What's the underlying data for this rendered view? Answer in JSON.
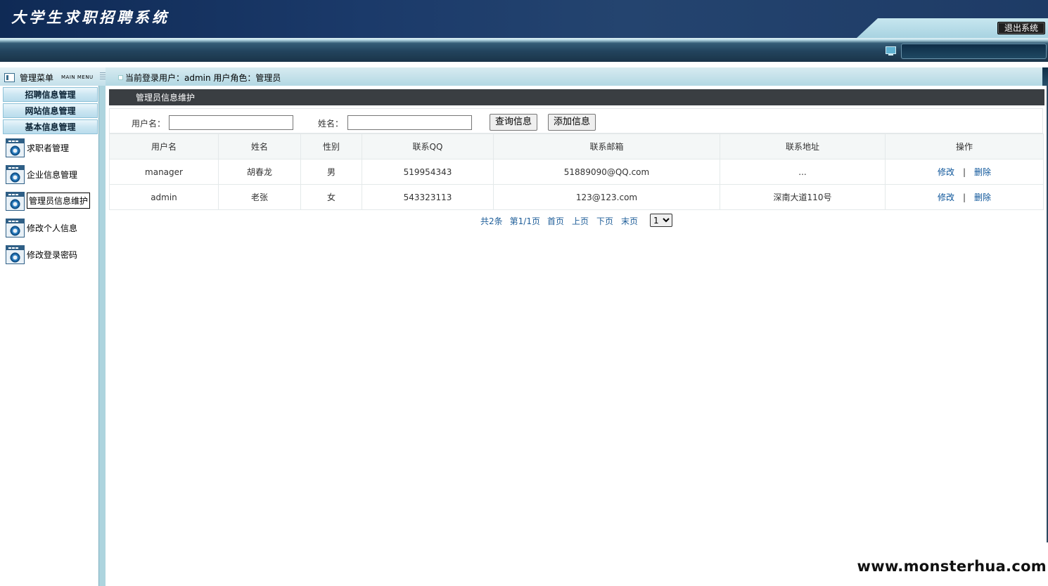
{
  "header": {
    "app_title": "大学生求职招聘系统",
    "logout_label": "退出系统"
  },
  "menu": {
    "title": "管理菜单",
    "subtitle": "MAIN MENU",
    "categories": [
      "招聘信息管理",
      "网站信息管理",
      "基本信息管理"
    ],
    "items": [
      "求职者管理",
      "企业信息管理",
      "管理员信息维护",
      "修改个人信息",
      "修改登录密码"
    ],
    "active_item": "管理员信息维护"
  },
  "userbar": {
    "info": "当前登录用户：admin  用户角色：管理员"
  },
  "main": {
    "section_title": "管理员信息维护",
    "search": {
      "username_label": "用户名：",
      "username_value": "",
      "name_label": "姓名：",
      "name_value": "",
      "query_button": "查询信息",
      "add_button": "添加信息"
    },
    "table": {
      "columns": [
        "用户名",
        "姓名",
        "性别",
        "联系QQ",
        "联系邮箱",
        "联系地址",
        "操作"
      ],
      "rows": [
        [
          "manager",
          "胡春龙",
          "男",
          "519954343",
          "51889090@QQ.com",
          "..."
        ],
        [
          "admin",
          "老张",
          "女",
          "543323113",
          "123@123.com",
          "深南大道110号"
        ]
      ],
      "edit_label": "修改",
      "separator": "|",
      "delete_label": "删除"
    },
    "pager": {
      "total": "共2条",
      "page_info": "第1/1页",
      "first": "首页",
      "prev": "上页",
      "next": "下页",
      "last": "末页",
      "selected_page": "1"
    }
  },
  "watermark": "www.monsterhua.com",
  "colors": {
    "header_dark": "#1b3a6a",
    "sidebar_accent": "#add4de",
    "link": "#0b5499",
    "section_bar": "#3a3e42"
  }
}
